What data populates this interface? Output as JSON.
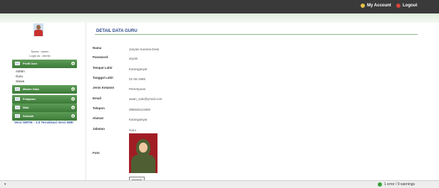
{
  "topbar": {
    "account_label": "My Account",
    "logout_label": "Logout"
  },
  "sidebar": {
    "user_name": "Nama : admin",
    "user_login": "Login as : Admin",
    "nav": [
      {
        "label": "Profil User",
        "icon": "user-icon",
        "subitems": [
          "Admin",
          "Guru",
          "Siswa"
        ]
      },
      {
        "label": "Master Data",
        "icon": "folder-icon",
        "subitems": []
      },
      {
        "label": "Pelajaran",
        "icon": "book-icon",
        "subitems": []
      },
      {
        "label": "Nilai",
        "icon": "chart-icon",
        "subitems": []
      },
      {
        "label": "Sekolah",
        "icon": "school-icon",
        "subitems": []
      }
    ],
    "version_text": "Versi SMTIK - 1.0 Terrakitasi Versi SMK"
  },
  "main": {
    "title": "DETAIL DATA GURU",
    "fields": [
      {
        "label": "Nama",
        "value": "Jaryani Kuseria Dewi"
      },
      {
        "label": "Password",
        "value": "aryani"
      },
      {
        "label": "Tempat Lahir",
        "value": "Karanganyar"
      },
      {
        "label": "Tanggal Lahir",
        "value": "01-06-1986"
      },
      {
        "label": "Jenis Kelamin",
        "value": "Perempuan"
      },
      {
        "label": "Email",
        "value": "awan_sule@ymail.com"
      },
      {
        "label": "Telepon",
        "value": "085645121800"
      },
      {
        "label": "Alamat",
        "value": "Karanganyar"
      },
      {
        "label": "Jabatan",
        "value": "Guru"
      },
      {
        "label": "Foto",
        "value": ""
      }
    ],
    "back_button": "kembali"
  },
  "statusbar": {
    "text": "1 error / 9 warnings"
  },
  "colors": {
    "topbar": "#3a3a3a",
    "nav_green": "#4b8a45",
    "title_blue": "#2c4a8a"
  }
}
